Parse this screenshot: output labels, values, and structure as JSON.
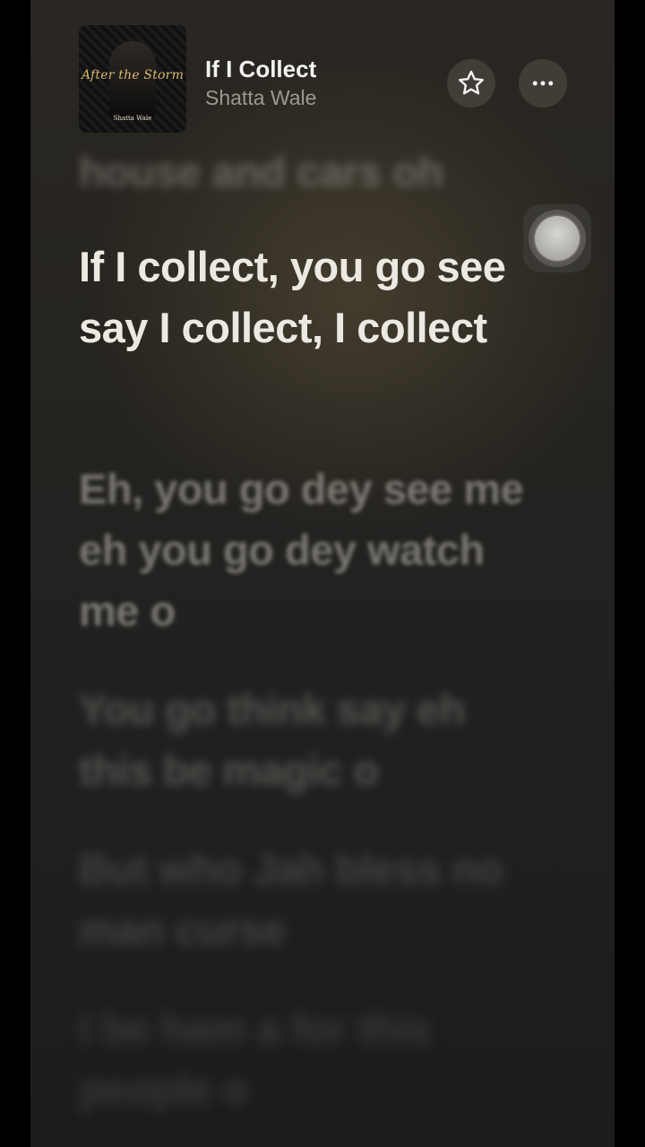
{
  "header": {
    "song_title": "If I Collect",
    "artist": "Shatta Wale",
    "album_art": {
      "album_name": "After the Storm",
      "artist_caption": "Shatta Wale"
    },
    "favorite_icon": "star-icon",
    "more_icon": "ellipsis-icon"
  },
  "lyrics": {
    "previous_line": "house and cars oh",
    "active_line": "If I collect, you go see say I collect, I collect",
    "upcoming": [
      "Eh, you go dey see me eh you go dey watch me o",
      "You go think say eh this be magic o",
      "But who Jah bless no man curse",
      "I be ham a for this people o"
    ]
  },
  "overlay": {
    "assistive_touch_icon": "assistive-touch-icon"
  },
  "colors": {
    "active_lyric": "#ece9e2",
    "title": "#f2f2f2",
    "subtitle": "#9b9890"
  }
}
